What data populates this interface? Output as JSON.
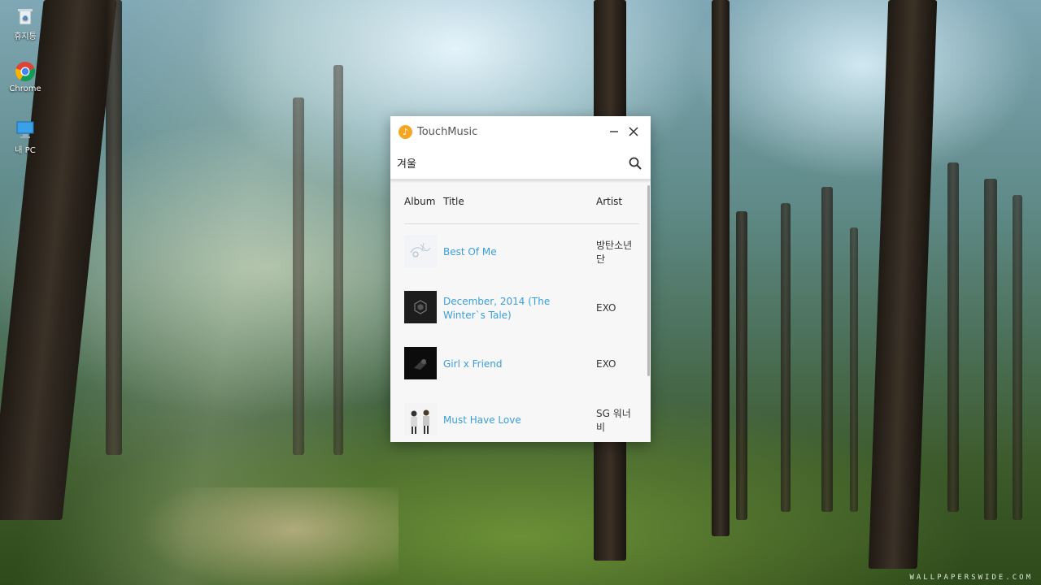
{
  "desktop": {
    "icons": [
      {
        "label": "휴지통",
        "icon": "recycle-bin-icon"
      },
      {
        "label": "Chrome",
        "icon": "chrome-icon"
      },
      {
        "label": "내 PC",
        "icon": "computer-icon"
      }
    ],
    "watermark": "WALLPAPERSWIDE.COM"
  },
  "window": {
    "title": "TouchMusic",
    "app_icon": "music-note-icon",
    "accent": "#f5a623",
    "link_color": "#3a9fd8"
  },
  "search": {
    "value": "겨울",
    "placeholder": ""
  },
  "table": {
    "headers": {
      "album": "Album",
      "title": "Title",
      "artist": "Artist"
    },
    "rows": [
      {
        "title": "Best Of Me",
        "artist": "방탄소년단"
      },
      {
        "title": "December, 2014 (The Winter`s Tale)",
        "artist": "EXO"
      },
      {
        "title": "Girl x Friend",
        "artist": "EXO"
      },
      {
        "title": "Must Have Love",
        "artist": "SG 워너비"
      }
    ]
  }
}
